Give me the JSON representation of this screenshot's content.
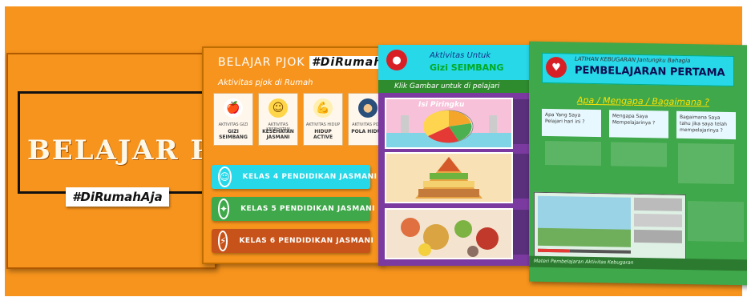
{
  "cover": {
    "title": "BELAJAR PJOK",
    "tag": "#DiRumahAja"
  },
  "menu": {
    "heading": "BELAJAR PJOK",
    "heading_tag": "#DiRumahAja",
    "subtitle": "Aktivitas pjok di Rumah",
    "cards": [
      {
        "icon": "apple-icon",
        "glyph": "🍎",
        "top": "AKTIVITAS GIZI",
        "label": "GIZI SEIMBANG"
      },
      {
        "icon": "smile-icon",
        "glyph": "☺",
        "top": "AKTIVITAS KESEHATAN",
        "label": "KESEHATAN JASMANI"
      },
      {
        "icon": "muscle-icon",
        "glyph": "💪",
        "top": "AKTIVITAS HIDUP",
        "label": "HIDUP ACTIVE"
      },
      {
        "icon": "head-icon",
        "glyph": "●",
        "top": "AKTIVITAS POLA",
        "label": "POLA HIDUP"
      }
    ],
    "buttons": [
      {
        "label": "KELAS 4  PENDIDIKAN JASMANI",
        "color": "#27d8e8",
        "glyph": "☺"
      },
      {
        "label": "KELAS 5  PENDIDIKAN JASMANI",
        "color": "#3fa84a",
        "glyph": "✦"
      },
      {
        "label": "KELAS 6  PENDIDIKAN JASMANI",
        "color": "#c8531a",
        "glyph": "⚡"
      }
    ]
  },
  "gizi": {
    "title_top": "Aktivitas Untuk",
    "title_main": "Gizi SEIMBANG",
    "band": "Klik Gambar untuk di pelajari",
    "thumb1_label": "Isi Piringku"
  },
  "latihan": {
    "header_small": "LATIHAN KEBUGARAN Jantungku Bahagia",
    "header_main": "PEMBELAJARAN PERTAMA",
    "question": "Apa / Mengapa / Bagaimana ?",
    "box1": "Apa Yang Saya Pelajari hari ini ?",
    "box2": "Mengapa Saya Mempelajarinya ?",
    "box3": "Bagaimana Saya tahu jika saya telah mempelajarinya ?",
    "footer": "Materi Pembelajaran Aktivitas Kebugaran"
  }
}
